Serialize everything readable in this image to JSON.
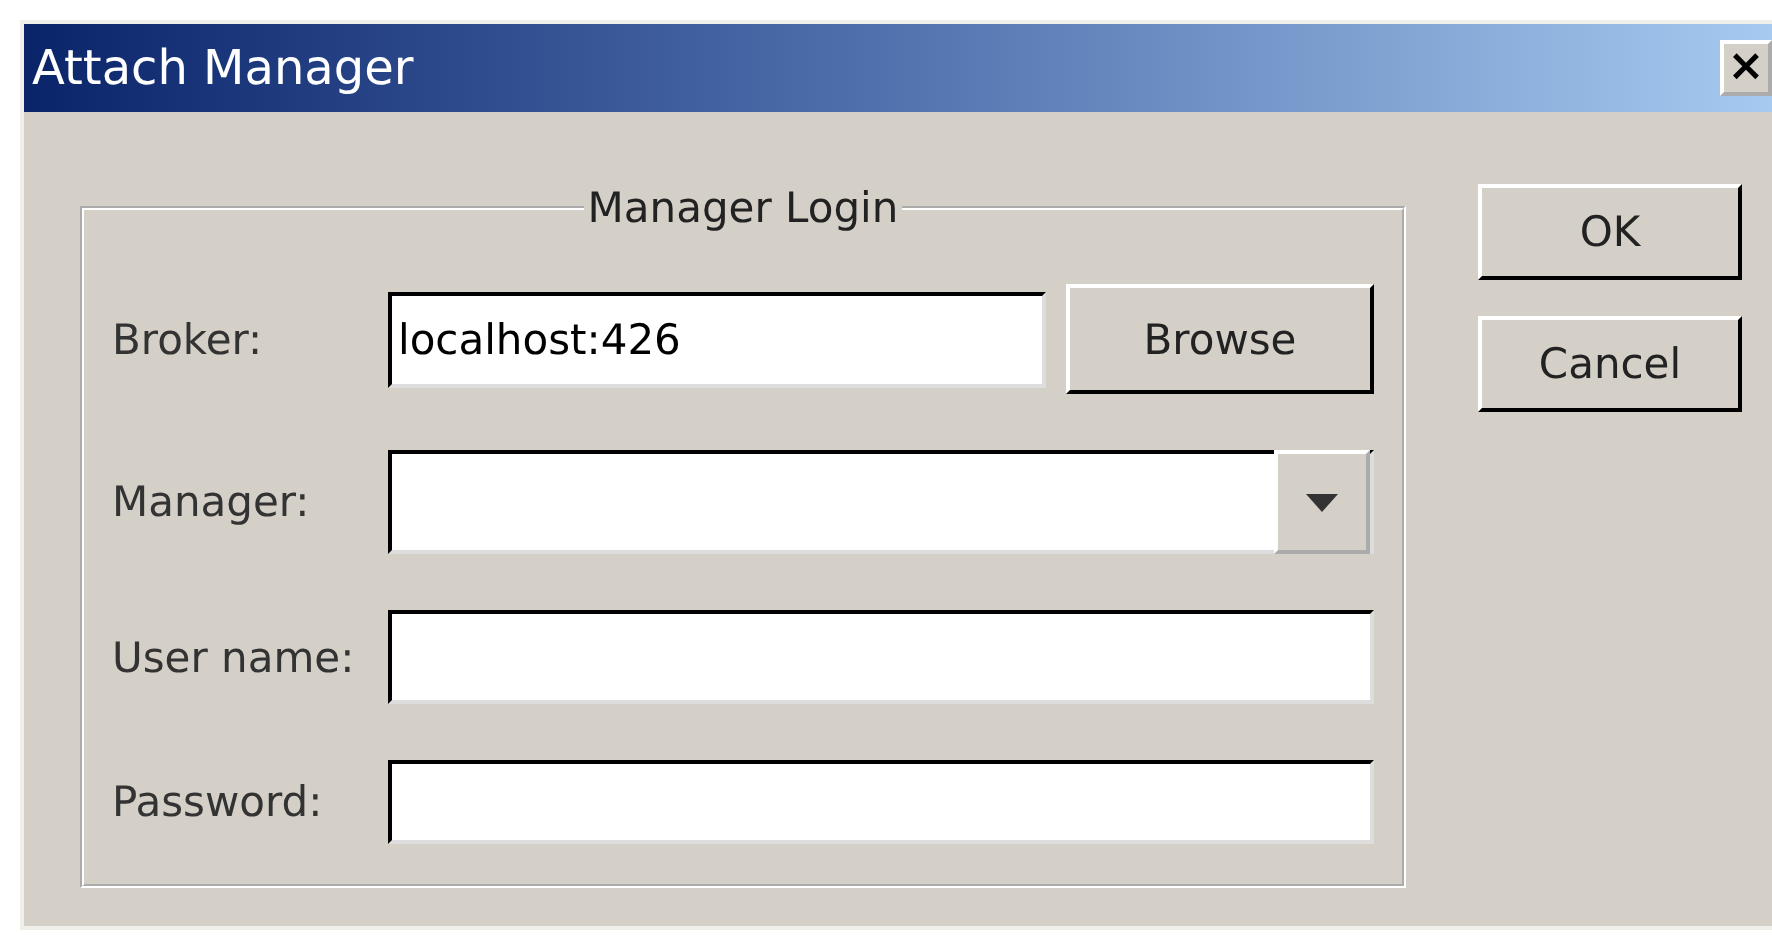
{
  "window": {
    "title": "Attach Manager",
    "close": "×"
  },
  "group": {
    "title": "Manager Login"
  },
  "fields": [
    {
      "label": "Broker:",
      "kind": "text",
      "value": "localhost:426",
      "button": "Browse"
    },
    {
      "label": "Manager:",
      "kind": "combo"
    },
    {
      "label": "User name:",
      "kind": "text"
    },
    {
      "label": "Password:",
      "kind": "password"
    }
  ],
  "buttons": [
    "OK",
    "Cancel"
  ]
}
